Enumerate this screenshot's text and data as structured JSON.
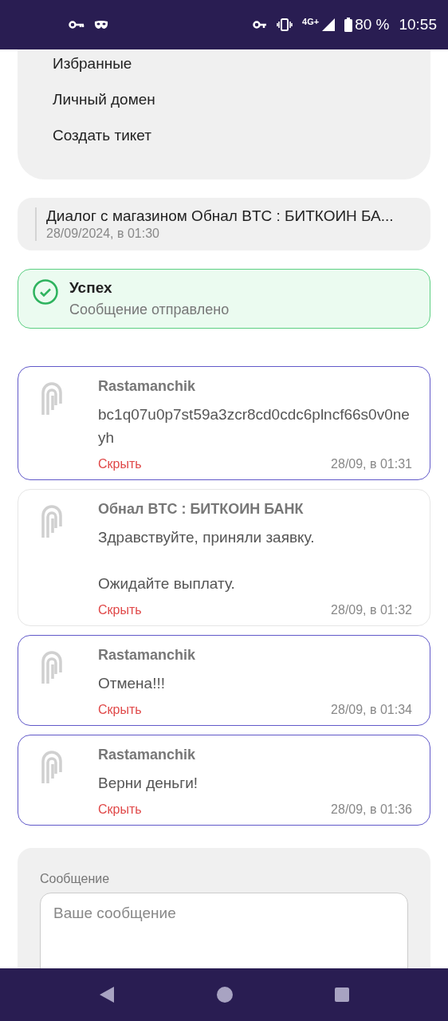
{
  "status_bar": {
    "battery": "80 %",
    "time": "10:55",
    "network": "4G+"
  },
  "menu": {
    "items": [
      "Избранные",
      "Личный домен",
      "Создать тикет"
    ]
  },
  "dialog": {
    "title": "Диалог с магазином Обнал BTC : БИТКОИН БА...",
    "date": "28/09/2024, в 01:30"
  },
  "alert": {
    "kind": "success",
    "title": "Успех",
    "text": "Сообщение отправлено"
  },
  "messages": [
    {
      "own": true,
      "author": "Rastamanchik",
      "text": "bc1q07u0p7st59a3zcr8cd0cdc6plncf66s0v0neyh",
      "action": "Скрыть",
      "time": "28/09, в 01:31"
    },
    {
      "own": false,
      "author": "Обнал BTC : БИТКОИН БАНК",
      "text": "Здравствуйте, приняли заявку.\n\nОжидайте выплату.",
      "action": "Скрыть",
      "time": "28/09, в 01:32"
    },
    {
      "own": true,
      "author": "Rastamanchik",
      "text": "Отмена!!!",
      "action": "Скрыть",
      "time": "28/09, в 01:34"
    },
    {
      "own": true,
      "author": "Rastamanchik",
      "text": "Верни деньги!",
      "action": "Скрыть",
      "time": "28/09, в 01:36"
    }
  ],
  "form": {
    "label": "Сообщение",
    "placeholder": "Ваше сообщение"
  }
}
